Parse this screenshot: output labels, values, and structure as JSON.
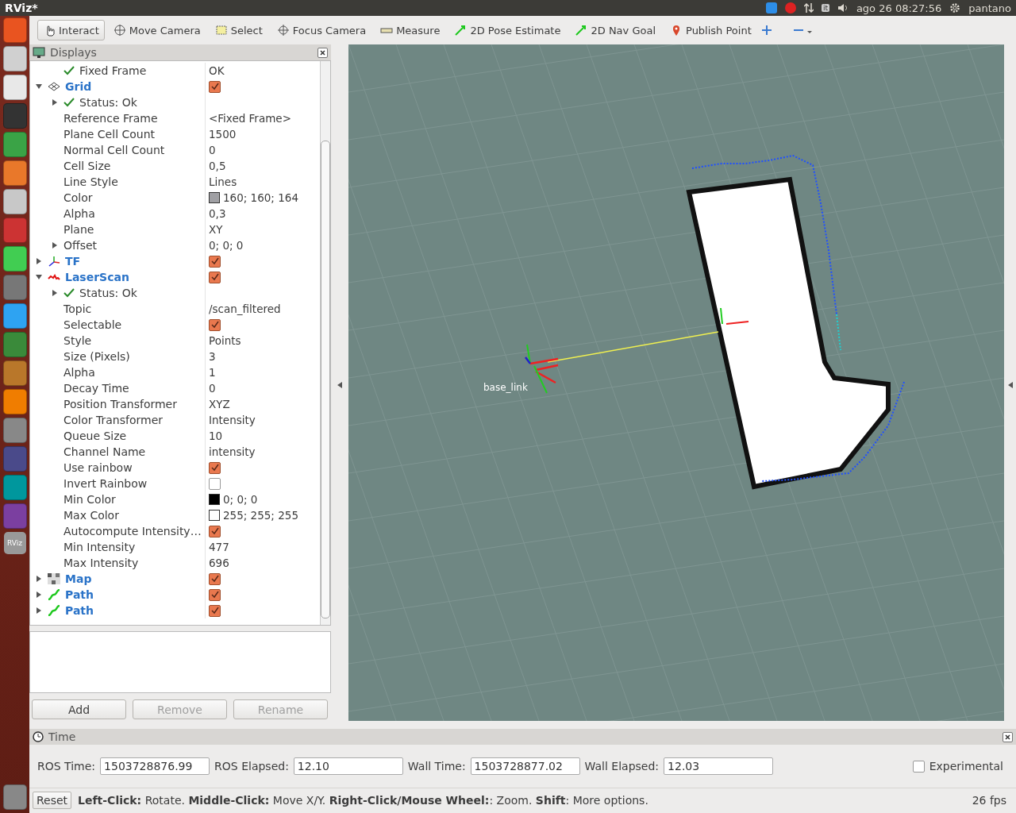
{
  "window": {
    "title": "RViz*"
  },
  "top_panel": {
    "clock": "ago 26 08:27:56",
    "user": "pantano",
    "keyboard_layout": "it"
  },
  "launcher": {
    "rviz_label": "RViz"
  },
  "toolbar": {
    "tools": [
      {
        "label": "Interact",
        "selected": true
      },
      {
        "label": "Move Camera",
        "selected": false
      },
      {
        "label": "Select",
        "selected": false
      },
      {
        "label": "Focus Camera",
        "selected": false
      },
      {
        "label": "Measure",
        "selected": false
      },
      {
        "label": "2D Pose Estimate",
        "selected": false
      },
      {
        "label": "2D Nav Goal",
        "selected": false
      },
      {
        "label": "Publish Point",
        "selected": false
      }
    ]
  },
  "displays": {
    "title": "Displays",
    "partial_children": [
      {
        "kind": "status",
        "name": "Fixed Frame",
        "value": "OK"
      }
    ],
    "items": [
      {
        "kind": "grid",
        "name": "Grid",
        "checked": true,
        "expanded": true,
        "children": [
          {
            "kind": "status",
            "name": "Status: Ok",
            "expanded": false
          },
          {
            "kind": "property",
            "name": "Reference Frame",
            "value": "<Fixed Frame>"
          },
          {
            "kind": "property",
            "name": "Plane Cell Count",
            "value": "1500"
          },
          {
            "kind": "property",
            "name": "Normal Cell Count",
            "value": "0"
          },
          {
            "kind": "property",
            "name": "Cell Size",
            "value": "0,5"
          },
          {
            "kind": "property",
            "name": "Line Style",
            "value": "Lines"
          },
          {
            "kind": "property",
            "name": "Color",
            "value": "160; 160; 164",
            "color": "#a0a0a4"
          },
          {
            "kind": "property",
            "name": "Alpha",
            "value": "0,3"
          },
          {
            "kind": "property",
            "name": "Plane",
            "value": "XY"
          },
          {
            "kind": "property",
            "name": "Offset",
            "value": "0; 0; 0",
            "expanded": false
          }
        ]
      },
      {
        "kind": "tf",
        "name": "TF",
        "checked": true,
        "expanded": false
      },
      {
        "kind": "laserscan",
        "name": "LaserScan",
        "checked": true,
        "expanded": true,
        "children": [
          {
            "kind": "status",
            "name": "Status: Ok",
            "expanded": false
          },
          {
            "kind": "property",
            "name": "Topic",
            "value": "/scan_filtered"
          },
          {
            "kind": "property",
            "name": "Selectable",
            "checked": true
          },
          {
            "kind": "property",
            "name": "Style",
            "value": "Points"
          },
          {
            "kind": "property",
            "name": "Size (Pixels)",
            "value": "3"
          },
          {
            "kind": "property",
            "name": "Alpha",
            "value": "1"
          },
          {
            "kind": "property",
            "name": "Decay Time",
            "value": "0"
          },
          {
            "kind": "property",
            "name": "Position Transformer",
            "value": "XYZ"
          },
          {
            "kind": "property",
            "name": "Color Transformer",
            "value": "Intensity"
          },
          {
            "kind": "property",
            "name": "Queue Size",
            "value": "10"
          },
          {
            "kind": "property",
            "name": "Channel Name",
            "value": "intensity"
          },
          {
            "kind": "property",
            "name": "Use rainbow",
            "checked": true
          },
          {
            "kind": "property",
            "name": "Invert Rainbow",
            "checked": false
          },
          {
            "kind": "property",
            "name": "Min Color",
            "value": "0; 0; 0",
            "color": "#000000"
          },
          {
            "kind": "property",
            "name": "Max Color",
            "value": "255; 255; 255",
            "color": "#ffffff"
          },
          {
            "kind": "property",
            "name": "Autocompute Intensity…",
            "checked": true
          },
          {
            "kind": "property",
            "name": "Min Intensity",
            "value": "477"
          },
          {
            "kind": "property",
            "name": "Max Intensity",
            "value": "696"
          }
        ]
      },
      {
        "kind": "map",
        "name": "Map",
        "checked": true,
        "expanded": false
      },
      {
        "kind": "path",
        "name": "Path",
        "checked": true,
        "expanded": false
      },
      {
        "kind": "path",
        "name": "Path",
        "checked": true,
        "expanded": false
      }
    ],
    "buttons": [
      {
        "label": "Add",
        "disabled": false
      },
      {
        "label": "Remove",
        "disabled": true
      },
      {
        "label": "Rename",
        "disabled": true
      }
    ]
  },
  "view": {
    "frame_label": "base_link"
  },
  "time_panel": {
    "title": "Time",
    "fields": [
      {
        "label": "ROS Time:",
        "value": "1503728876.99"
      },
      {
        "label": "ROS Elapsed:",
        "value": "12.10"
      },
      {
        "label": "Wall Time:",
        "value": "1503728877.02"
      },
      {
        "label": "Wall Elapsed:",
        "value": "12.03"
      }
    ],
    "experimental": {
      "label": "Experimental",
      "checked": false
    }
  },
  "status_bar": {
    "reset": "Reset",
    "help": "**Left-Click:** Rotate. **Middle-Click:** Move X/Y. **Right-Click/Mouse Wheel:**: Zoom. **Shift**: More options.",
    "fps": "26 fps"
  }
}
